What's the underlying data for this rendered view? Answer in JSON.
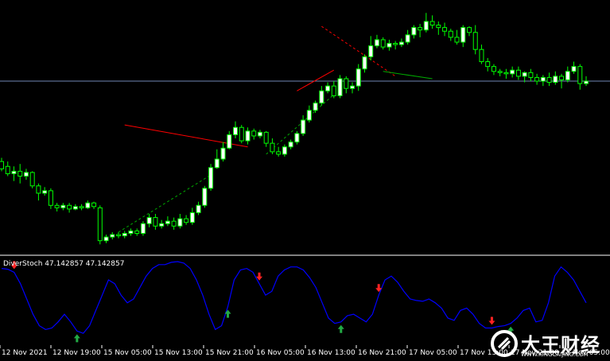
{
  "indicator": {
    "title": "DiverStoch 47.142857 47.142857"
  },
  "colors": {
    "background": "#000000",
    "bull_candle": "#ffffff",
    "bear_candle": "#000000",
    "candle_outline": "#00ff00",
    "stoch_line": "#0000ff",
    "divergence_bear": "#ff0000",
    "divergence_bull": "#00aa00",
    "price_level": "#6f86b3",
    "separator": "#ffffff",
    "arrow_down": "#ff2222",
    "arrow_up": "#22aa44"
  },
  "x_axis": {
    "labels": [
      "12 Nov 2021",
      "12 Nov 19:00",
      "15 Nov 05:00",
      "15 Nov 13:00",
      "15 Nov 21:00",
      "16 Nov 05:00",
      "16 Nov 13:00",
      "16 Nov 21:00",
      "17 Nov 05:00",
      "17 Nov 13:00",
      "17 Nov 21:00",
      "18 Nov 05:00"
    ]
  },
  "watermark": {
    "title": "大王财经",
    "subtitle": "WWW.KINGCAIJING.COM",
    "icon": "logo-icon"
  },
  "chart_data": [
    {
      "type": "candlestick",
      "title": "",
      "note_values": "relative price units (no price scale visible)",
      "candles": [
        [
          30,
          24,
          33,
          22
        ],
        [
          26,
          20,
          30,
          18
        ],
        [
          20,
          22,
          26,
          14
        ],
        [
          22,
          18,
          28,
          12
        ],
        [
          18,
          21,
          24,
          15
        ],
        [
          21,
          10,
          22,
          8
        ],
        [
          10,
          4,
          12,
          -2
        ],
        [
          4,
          6,
          9,
          2
        ],
        [
          6,
          -6,
          8,
          -9
        ],
        [
          -6,
          -8,
          -4,
          -11
        ],
        [
          -8,
          -6,
          -4,
          -10
        ],
        [
          -6,
          -9,
          -4,
          -12
        ],
        [
          -9,
          -7,
          -5,
          -10
        ],
        [
          -7,
          -8,
          -5,
          -10
        ],
        [
          -8,
          -4,
          -2,
          -9
        ],
        [
          -4,
          -7,
          -3,
          -9
        ],
        [
          -8,
          -35,
          -6,
          -38
        ],
        [
          -35,
          -32,
          -30,
          -37
        ],
        [
          -32,
          -30,
          -28,
          -34
        ],
        [
          -30,
          -31,
          -28,
          -33
        ],
        [
          -31,
          -29,
          -27,
          -33
        ],
        [
          -29,
          -27,
          -25,
          -31
        ],
        [
          -27,
          -29,
          -25,
          -31
        ],
        [
          -29,
          -21,
          -19,
          -31
        ],
        [
          -21,
          -16,
          -13,
          -24
        ],
        [
          -16,
          -23,
          -13,
          -26
        ],
        [
          -23,
          -21,
          -18,
          -25
        ],
        [
          -21,
          -19,
          -15,
          -23
        ],
        [
          -19,
          -23,
          -16,
          -26
        ],
        [
          -23,
          -17,
          -13,
          -25
        ],
        [
          -17,
          -20,
          -14,
          -22
        ],
        [
          -20,
          -12,
          -8,
          -22
        ],
        [
          -12,
          -6,
          -3,
          -14
        ],
        [
          -6,
          8,
          10,
          -8
        ],
        [
          8,
          25,
          28,
          6
        ],
        [
          25,
          32,
          40,
          24
        ],
        [
          32,
          41,
          46,
          30
        ],
        [
          41,
          52,
          55,
          40
        ],
        [
          52,
          58,
          63,
          49
        ],
        [
          58,
          47,
          60,
          45
        ],
        [
          47,
          55,
          58,
          44
        ],
        [
          55,
          51,
          57,
          48
        ],
        [
          51,
          54,
          56,
          49
        ],
        [
          54,
          45,
          55,
          42
        ],
        [
          45,
          38,
          49,
          36
        ],
        [
          38,
          36,
          42,
          34
        ],
        [
          36,
          42,
          44,
          34
        ],
        [
          42,
          46,
          48,
          40
        ],
        [
          46,
          53,
          55,
          44
        ],
        [
          53,
          64,
          68,
          51
        ],
        [
          64,
          72,
          76,
          62
        ],
        [
          72,
          78,
          80,
          70
        ],
        [
          78,
          88,
          92,
          76
        ],
        [
          88,
          92,
          95,
          86
        ],
        [
          92,
          84,
          96,
          82
        ],
        [
          84,
          98,
          101,
          82
        ],
        [
          98,
          90,
          100,
          86
        ],
        [
          90,
          92,
          95,
          86
        ],
        [
          92,
          106,
          110,
          88
        ],
        [
          106,
          116,
          118,
          103
        ],
        [
          116,
          125,
          133,
          113
        ],
        [
          125,
          130,
          134,
          123
        ],
        [
          130,
          124,
          132,
          122
        ],
        [
          124,
          127,
          130,
          121
        ],
        [
          127,
          126,
          129,
          122
        ],
        [
          126,
          128,
          131,
          124
        ],
        [
          128,
          134,
          138,
          126
        ],
        [
          134,
          140,
          142,
          131
        ],
        [
          140,
          138,
          143,
          132
        ],
        [
          138,
          145,
          152,
          136
        ],
        [
          145,
          142,
          150,
          139
        ],
        [
          142,
          140,
          145,
          134
        ],
        [
          140,
          137,
          144,
          133
        ],
        [
          137,
          132,
          139,
          129
        ],
        [
          132,
          128,
          138,
          126
        ],
        [
          128,
          140,
          142,
          124
        ],
        [
          140,
          136,
          141,
          133
        ],
        [
          136,
          122,
          142,
          118
        ],
        [
          122,
          112,
          126,
          110
        ],
        [
          112,
          108,
          115,
          104
        ],
        [
          108,
          104,
          110,
          101
        ],
        [
          104,
          103,
          106,
          100
        ],
        [
          103,
          102,
          106,
          98
        ],
        [
          102,
          105,
          108,
          99
        ],
        [
          105,
          100,
          108,
          97
        ],
        [
          100,
          103,
          104,
          95
        ],
        [
          103,
          99,
          106,
          96
        ],
        [
          99,
          96,
          102,
          93
        ],
        [
          96,
          99,
          101,
          92
        ],
        [
          99,
          95,
          103,
          92
        ],
        [
          95,
          100,
          104,
          93
        ],
        [
          100,
          97,
          102,
          90
        ],
        [
          97,
          104,
          108,
          95
        ],
        [
          104,
          108,
          112,
          102
        ],
        [
          108,
          94,
          110,
          89
        ],
        [
          94,
          96,
          100,
          92
        ]
      ],
      "price_level": 96,
      "divergence_lines": [
        {
          "style": "solid",
          "color": "bear",
          "from": [
            20,
            60
          ],
          "to": [
            40,
            42
          ]
        },
        {
          "style": "dashed",
          "color": "bull",
          "from": [
            19,
            -28
          ],
          "to": [
            34,
            19
          ]
        },
        {
          "style": "dashed",
          "color": "bull",
          "from": [
            43,
            36
          ],
          "to": [
            54,
            85
          ]
        },
        {
          "style": "solid",
          "color": "bear",
          "from": [
            48,
            88
          ],
          "to": [
            54,
            105
          ]
        },
        {
          "style": "dashed",
          "color": "bear",
          "from": [
            52,
            141
          ],
          "to": [
            64,
            100
          ]
        },
        {
          "style": "solid",
          "color": "bull",
          "from": [
            62,
            104
          ],
          "to": [
            70,
            98
          ]
        }
      ]
    },
    {
      "type": "line",
      "title": "DiverStoch 47.142857 47.142857",
      "ylim": [
        0,
        100
      ],
      "series": [
        {
          "values": [
            90,
            89,
            85,
            70,
            50,
            30,
            15,
            10,
            12,
            20,
            30,
            20,
            8,
            5,
            15,
            35,
            55,
            75,
            70,
            55,
            45,
            50,
            65,
            80,
            90,
            95,
            95,
            98,
            99,
            97,
            90,
            75,
            55,
            30,
            10,
            15,
            40,
            75,
            88,
            90,
            85,
            70,
            55,
            60,
            80,
            88,
            92,
            92,
            88,
            78,
            65,
            45,
            25,
            18,
            20,
            28,
            30,
            25,
            20,
            30,
            55,
            75,
            80,
            72,
            60,
            50,
            48,
            47,
            50,
            45,
            38,
            25,
            22,
            35,
            38,
            30,
            18,
            12,
            12,
            14,
            15,
            18,
            25,
            35,
            38,
            20,
            22,
            45,
            80,
            92,
            85,
            75,
            60,
            45
          ]
        }
      ],
      "signals": [
        {
          "type": "sell",
          "index": 2
        },
        {
          "type": "buy",
          "index": 12
        },
        {
          "type": "buy",
          "index": 36
        },
        {
          "type": "sell",
          "index": 41
        },
        {
          "type": "buy",
          "index": 54
        },
        {
          "type": "sell",
          "index": 60
        },
        {
          "type": "sell",
          "index": 78
        },
        {
          "type": "buy",
          "index": 81
        }
      ]
    }
  ]
}
